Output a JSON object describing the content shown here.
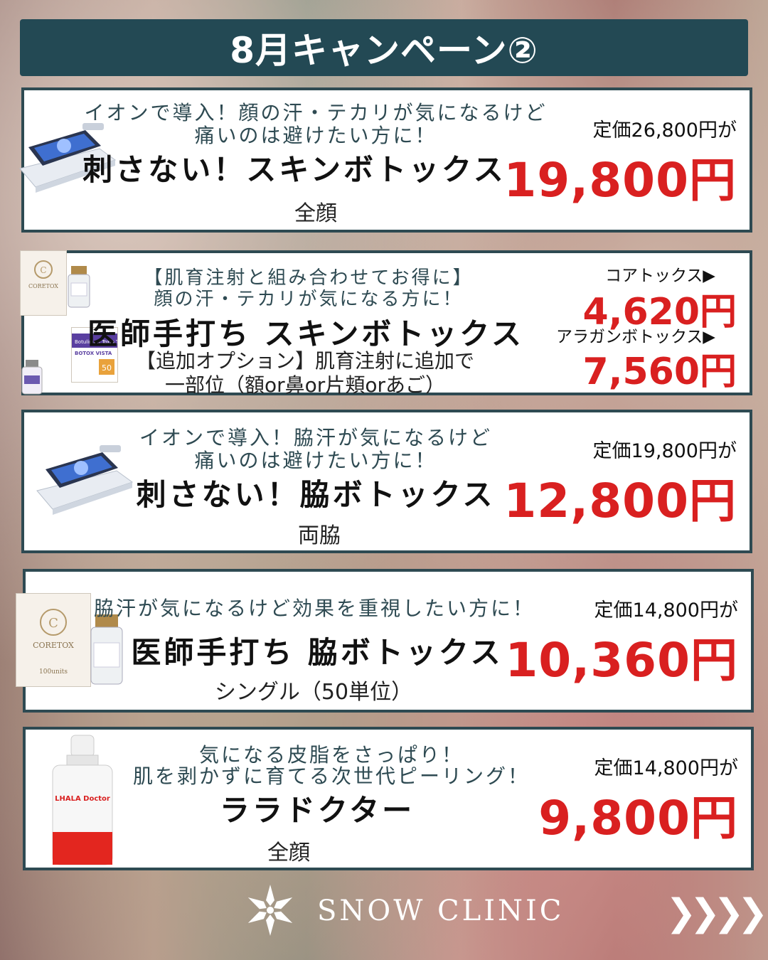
{
  "header": {
    "title": "8月キャンペーン②"
  },
  "cards": [
    {
      "tagline1": "イオンで導入！顔の汗・テカリが気になるけど",
      "tagline2": "痛いのは避けたい方に！",
      "title": "刺さない！スキンボトックス",
      "area": "全顔",
      "original_price": "定価26,800円が",
      "sale_price": "19,800円"
    },
    {
      "tagline1": "【肌育注射と組み合わせてお得に】",
      "tagline2": "顔の汗・テカリが気になる方に！",
      "title": "医師手打ち スキンボトックス",
      "note1": "【追加オプション】肌育注射に追加で",
      "note2": "一部位（額or鼻or片頬orあご）",
      "option1_label": "コアトックス▶",
      "option1_price": "4,620円",
      "option2_label": "アラガンボトックス▶",
      "option2_price": "7,560円",
      "product_box_label": "CORETOX",
      "product_box2_label": "Botulinum Toxin Type A",
      "product_box2_sub": "BOTOX VISTA",
      "product_box2_units": "50"
    },
    {
      "tagline1": "イオンで導入！脇汗が気になるけど",
      "tagline2": "痛いのは避けたい方に！",
      "title": "刺さない！脇ボトックス",
      "area": "両脇",
      "original_price": "定価19,800円が",
      "sale_price": "12,800円"
    },
    {
      "tagline1": "脇汗が気になるけど効果を重視したい方に！",
      "title": "医師手打ち 脇ボトックス",
      "area": "シングル（50単位）",
      "original_price": "定価14,800円が",
      "sale_price": "10,360円",
      "product_box_label": "CORETOX",
      "product_box_units": "100units"
    },
    {
      "tagline1": "気になる皮脂をさっぱり！",
      "tagline2": "肌を剥かずに育てる次世代ピーリング！",
      "title": "ララドクター",
      "area": "全顔",
      "original_price": "定価14,800円が",
      "sale_price": "9,800円",
      "bottle_label": "LHALA Doctor"
    }
  ],
  "footer": {
    "brand": "SNOW CLINIC",
    "next_arrows": "❯❯❯❯"
  },
  "colors": {
    "header_bg": "#234954",
    "card_border": "#2e4a52",
    "sale_red": "#d92020"
  }
}
